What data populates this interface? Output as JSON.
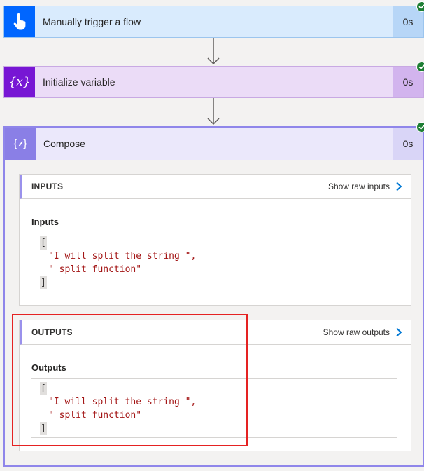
{
  "steps": [
    {
      "title": "Manually trigger a flow",
      "duration": "0s"
    },
    {
      "title": "Initialize variable",
      "duration": "0s"
    }
  ],
  "compose": {
    "title": "Compose",
    "duration": "0s",
    "inputs_panel": {
      "header": "INPUTS",
      "raw_link": "Show raw inputs",
      "label": "Inputs",
      "open_bracket": "[",
      "lines": [
        "\"I will split the string \",",
        "\" split function\""
      ],
      "close_bracket": "]"
    },
    "outputs_panel": {
      "header": "OUTPUTS",
      "raw_link": "Show raw outputs",
      "label": "Outputs",
      "open_bracket": "[",
      "lines": [
        "\"I will split the string \",",
        "\" split function\""
      ],
      "close_bracket": "]"
    }
  },
  "icons": {
    "trigger": "touch-hand-icon",
    "variable": "variable-x-icon",
    "compose": "compose-braces-icon",
    "success": "checkmark-icon",
    "chevron": "chevron-right-icon"
  },
  "colors": {
    "trigger_accent": "#0066ff",
    "variable_accent": "#7716d4",
    "compose_accent": "#8a7fe6",
    "success": "#1e7e34",
    "string_literal": "#a31515",
    "link_blue": "#0078d4",
    "highlight_red": "#e52222"
  }
}
